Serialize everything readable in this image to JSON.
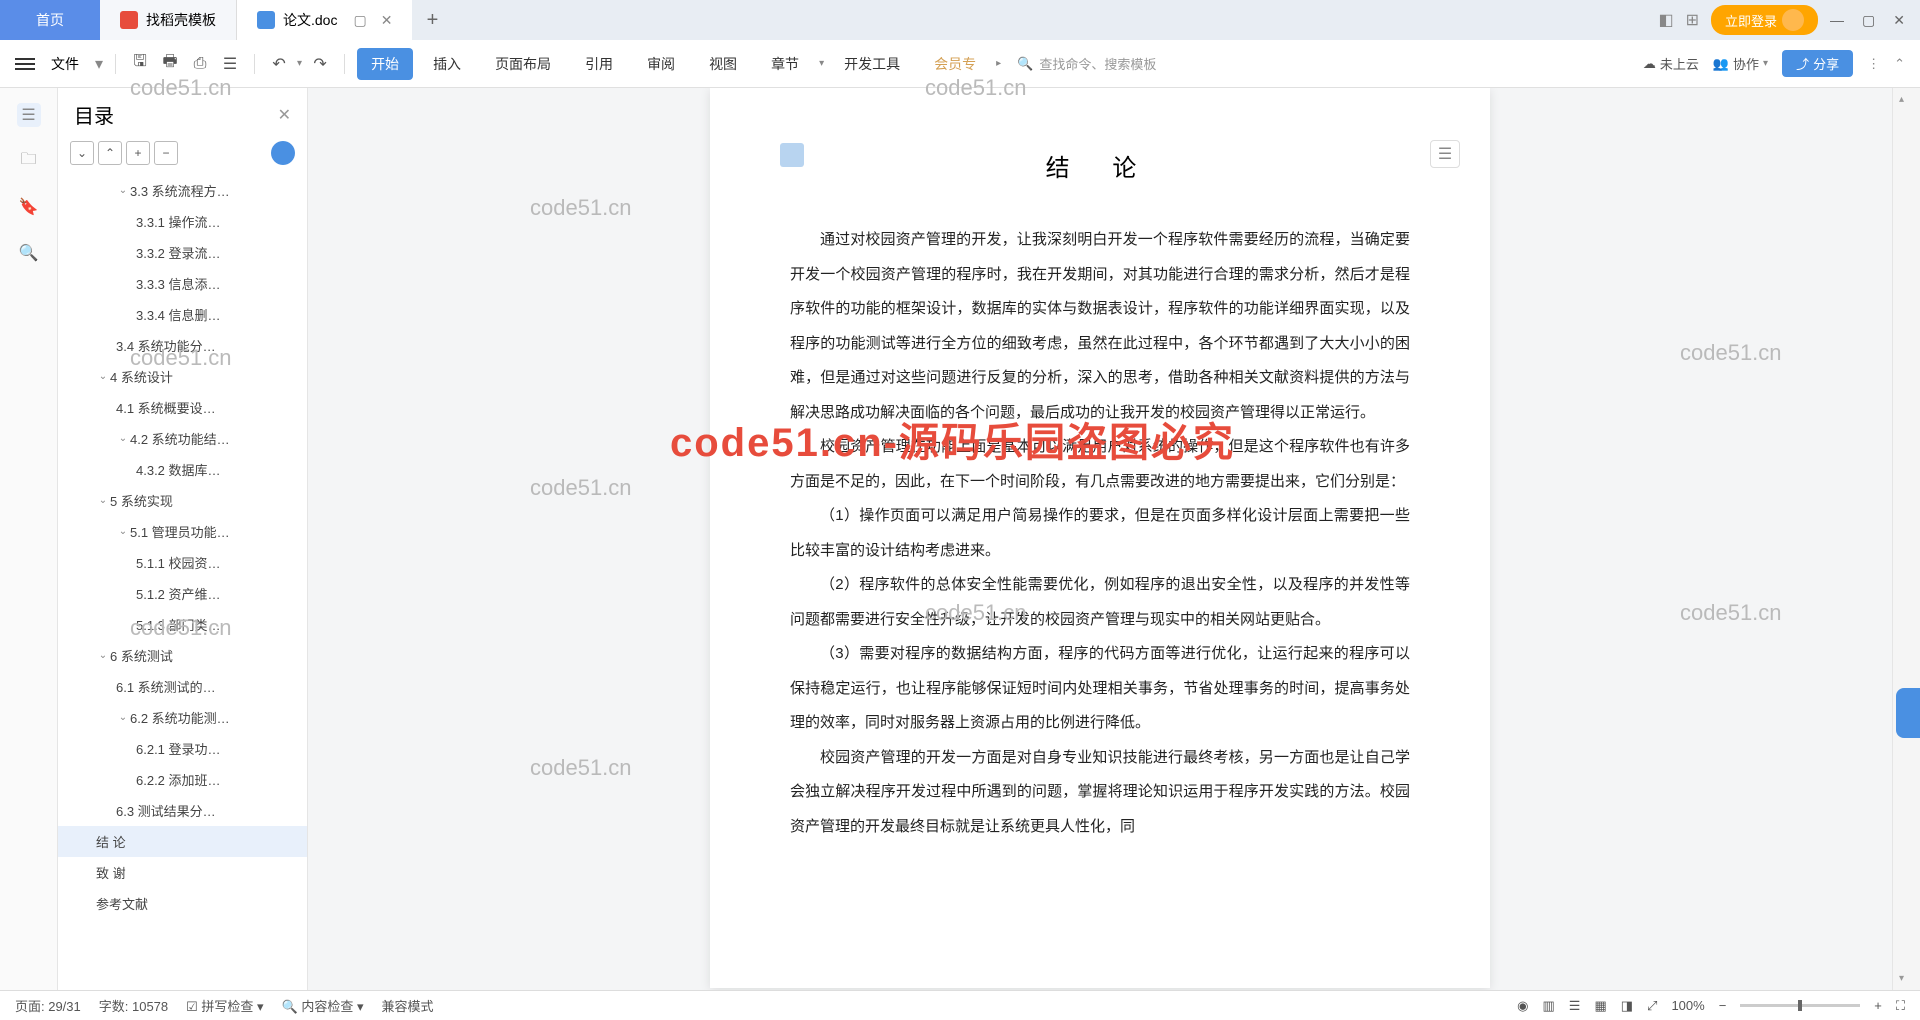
{
  "tabs": {
    "home": "首页",
    "template": "找稻壳模板",
    "doc": "论文.doc"
  },
  "top_right": {
    "login": "立即登录"
  },
  "ribbon": {
    "file": "文件",
    "menus": [
      "开始",
      "插入",
      "页面布局",
      "引用",
      "审阅",
      "视图",
      "章节",
      "开发工具",
      "会员专"
    ],
    "search_placeholder": "查找命令、搜索模板",
    "cloud": "未上云",
    "collab": "协作",
    "share": "分享"
  },
  "outline": {
    "title": "目录",
    "items": [
      {
        "label": "3.3 系统流程方…",
        "indent": 3,
        "chev": true
      },
      {
        "label": "3.3.1 操作流…",
        "indent": 4
      },
      {
        "label": "3.3.2 登录流…",
        "indent": 4
      },
      {
        "label": "3.3.3 信息添…",
        "indent": 4
      },
      {
        "label": "3.3.4 信息删…",
        "indent": 4
      },
      {
        "label": "3.4 系统功能分…",
        "indent": 3
      },
      {
        "label": "4 系统设计",
        "indent": 2,
        "chev": true
      },
      {
        "label": "4.1 系统概要设…",
        "indent": 3
      },
      {
        "label": "4.2 系统功能结…",
        "indent": 3,
        "chev": true
      },
      {
        "label": "4.3.2 数据库…",
        "indent": 4
      },
      {
        "label": "5 系统实现",
        "indent": 2,
        "chev": true
      },
      {
        "label": "5.1 管理员功能…",
        "indent": 3,
        "chev": true
      },
      {
        "label": "5.1.1 校园资…",
        "indent": 4
      },
      {
        "label": "5.1.2 资产维…",
        "indent": 4
      },
      {
        "label": "5.1.3 部门类…",
        "indent": 4
      },
      {
        "label": "6 系统测试",
        "indent": 2,
        "chev": true
      },
      {
        "label": "6.1 系统测试的…",
        "indent": 3
      },
      {
        "label": "6.2 系统功能测…",
        "indent": 3,
        "chev": true
      },
      {
        "label": "6.2.1 登录功…",
        "indent": 4
      },
      {
        "label": "6.2.2 添加班…",
        "indent": 4
      },
      {
        "label": "6.3 测试结果分…",
        "indent": 3
      },
      {
        "label": "结   论",
        "indent": 2,
        "active": true
      },
      {
        "label": "致   谢",
        "indent": 2
      },
      {
        "label": "参考文献",
        "indent": 2
      }
    ]
  },
  "doc": {
    "title": "结   论",
    "p1": "通过对校园资产管理的开发，让我深刻明白开发一个程序软件需要经历的流程，当确定要开发一个校园资产管理的程序时，我在开发期间，对其功能进行合理的需求分析，然后才是程序软件的功能的框架设计，数据库的实体与数据表设计，程序软件的功能详细界面实现，以及程序的功能测试等进行全方位的细致考虑，虽然在此过程中，各个环节都遇到了大大小小的困难，但是通过对这些问题进行反复的分析，深入的思考，借助各种相关文献资料提供的方法与解决思路成功解决面临的各个问题，最后成功的让我开发的校园资产管理得以正常运行。",
    "p2": "校园资产管理在功能上面是基本可以满足用户对系统的操作，但是这个程序软件也有许多方面是不足的，因此，在下一个时间阶段，有几点需要改进的地方需要提出来，它们分别是：",
    "p3": "（1）操作页面可以满足用户简易操作的要求，但是在页面多样化设计层面上需要把一些比较丰富的设计结构考虑进来。",
    "p4": "（2）程序软件的总体安全性能需要优化，例如程序的退出安全性，以及程序的并发性等问题都需要进行安全性升级，让开发的校园资产管理与现实中的相关网站更贴合。",
    "p5": "（3）需要对程序的数据结构方面，程序的代码方面等进行优化，让运行起来的程序可以保持稳定运行，也让程序能够保证短时间内处理相关事务，节省处理事务的时间，提高事务处理的效率，同时对服务器上资源占用的比例进行降低。",
    "p6": "校园资产管理的开发一方面是对自身专业知识技能进行最终考核，另一方面也是让自己学会独立解决程序开发过程中所遇到的问题，掌握将理论知识运用于程序开发实践的方法。校园资产管理的开发最终目标就是让系统更具人性化，同"
  },
  "status": {
    "page": "页面: 29/31",
    "words": "字数: 10578",
    "spell": "拼写检查",
    "content": "内容检查",
    "compat": "兼容模式",
    "zoom": "100%"
  },
  "watermarks": {
    "code": "code51.cn",
    "big": "code51.cn-源码乐园盗图必究"
  }
}
